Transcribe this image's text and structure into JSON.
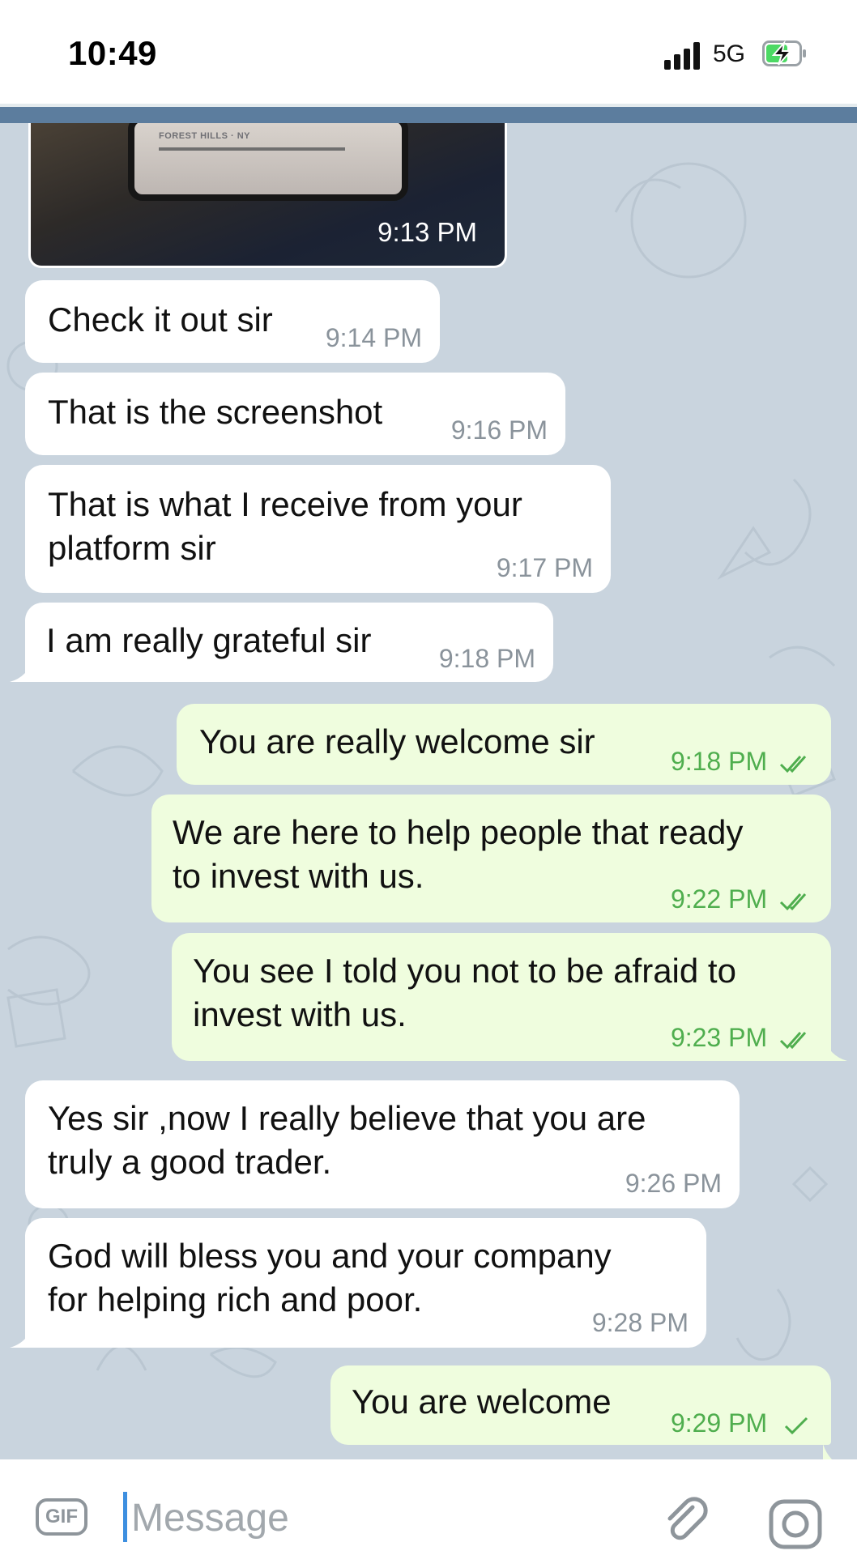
{
  "status_bar": {
    "time": "10:49",
    "network": "5G",
    "battery_charging": true
  },
  "photo_message": {
    "card_text": "FOREST HILLS · NY",
    "time": "9:13 PM"
  },
  "messages": [
    {
      "direction": "incoming",
      "text_lines": [
        "Check it out sir"
      ],
      "time": "9:14 PM"
    },
    {
      "direction": "incoming",
      "text_lines": [
        "That is the screenshot"
      ],
      "time": "9:16 PM"
    },
    {
      "direction": "incoming",
      "text_lines": [
        "That is what I receive from your",
        "platform sir"
      ],
      "time": "9:17 PM"
    },
    {
      "direction": "incoming",
      "text_lines": [
        "I am really grateful sir"
      ],
      "time": "9:18 PM"
    },
    {
      "direction": "outgoing",
      "text_lines": [
        "You are really welcome sir"
      ],
      "time": "9:18 PM",
      "status": "read"
    },
    {
      "direction": "outgoing",
      "text_lines": [
        "We are here to help people that ready",
        "to invest with us."
      ],
      "time": "9:22 PM",
      "status": "read"
    },
    {
      "direction": "outgoing",
      "text_lines": [
        "You see I told you not to be afraid to",
        "invest with us."
      ],
      "time": "9:23 PM",
      "status": "read"
    },
    {
      "direction": "incoming",
      "text_lines": [
        "Yes sir ,now I really believe that you are",
        "truly a  good trader."
      ],
      "time": "9:26 PM"
    },
    {
      "direction": "incoming",
      "text_lines": [
        "God will bless you and your company",
        "for helping rich and poor."
      ],
      "time": "9:28 PM"
    },
    {
      "direction": "outgoing",
      "text_lines": [
        "You are welcome"
      ],
      "time": "9:29 PM",
      "status": "sent"
    }
  ],
  "input_bar": {
    "gif_label": "GIF",
    "placeholder": "Message"
  },
  "colors": {
    "chat_background": "#c9d4de",
    "incoming_bubble": "#ffffff",
    "outgoing_bubble": "#effdde",
    "outgoing_meta": "#4fae4e",
    "header_accent": "#5c7d9e"
  },
  "icons": [
    "signal-icon",
    "battery-charging-icon",
    "double-check-icon",
    "single-check-icon",
    "attach-icon",
    "camera-icon"
  ]
}
